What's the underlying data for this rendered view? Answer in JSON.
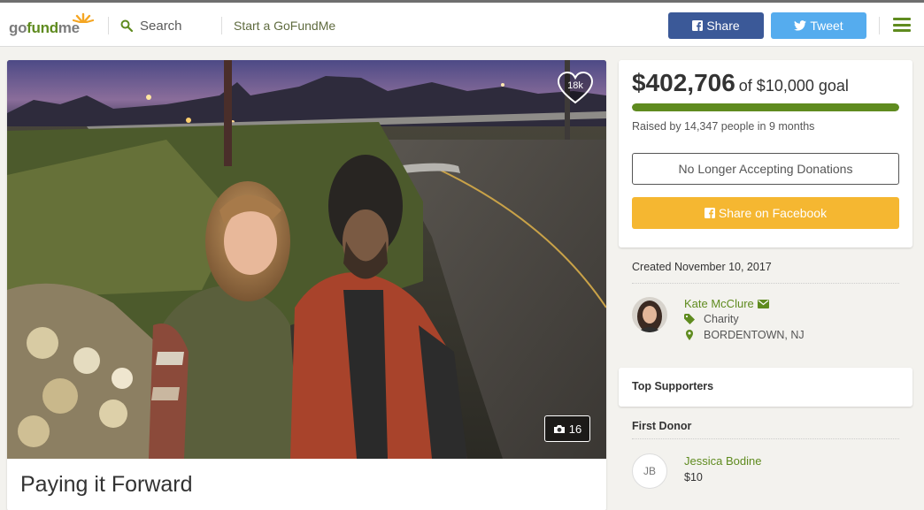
{
  "header": {
    "logo": "gofundme",
    "search_label": "Search",
    "start_label": "Start a GoFundMe",
    "share_label": "Share",
    "tweet_label": "Tweet"
  },
  "campaign": {
    "title": "Paying it Forward",
    "hearts": "18k",
    "photo_count": "16"
  },
  "donation": {
    "raised": "$402,706",
    "goal_text": "of $10,000 goal",
    "progress_fraction": 1.0,
    "raised_by": "Raised by 14,347 people in 9 months",
    "no_longer_label": "No Longer Accepting Donations",
    "share_fb_label": "Share on Facebook"
  },
  "organizer": {
    "created": "Created November 10, 2017",
    "name": "Kate McClure",
    "category": "Charity",
    "location": "BORDENTOWN, NJ"
  },
  "supporters": {
    "title": "Top Supporters"
  },
  "first_donor": {
    "title": "First Donor",
    "initials": "JB",
    "name": "Jessica Bodine",
    "amount": "$10"
  },
  "colors": {
    "brand_green": "#5f8b1f",
    "facebook": "#3b5998",
    "twitter": "#55acee",
    "share_yellow": "#f5b731"
  }
}
